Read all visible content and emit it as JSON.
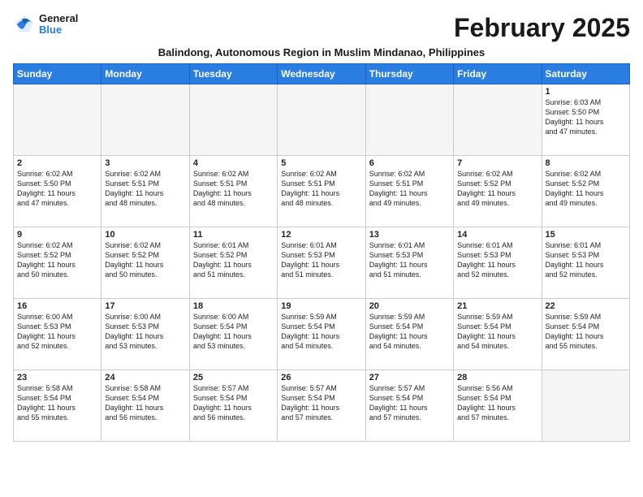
{
  "logo": {
    "line1": "General",
    "line2": "Blue"
  },
  "title": "February 2025",
  "subtitle": "Balindong, Autonomous Region in Muslim Mindanao, Philippines",
  "weekdays": [
    "Sunday",
    "Monday",
    "Tuesday",
    "Wednesday",
    "Thursday",
    "Friday",
    "Saturday"
  ],
  "weeks": [
    [
      {
        "day": "",
        "info": ""
      },
      {
        "day": "",
        "info": ""
      },
      {
        "day": "",
        "info": ""
      },
      {
        "day": "",
        "info": ""
      },
      {
        "day": "",
        "info": ""
      },
      {
        "day": "",
        "info": ""
      },
      {
        "day": "1",
        "info": "Sunrise: 6:03 AM\nSunset: 5:50 PM\nDaylight: 11 hours\nand 47 minutes."
      }
    ],
    [
      {
        "day": "2",
        "info": "Sunrise: 6:02 AM\nSunset: 5:50 PM\nDaylight: 11 hours\nand 47 minutes."
      },
      {
        "day": "3",
        "info": "Sunrise: 6:02 AM\nSunset: 5:51 PM\nDaylight: 11 hours\nand 48 minutes."
      },
      {
        "day": "4",
        "info": "Sunrise: 6:02 AM\nSunset: 5:51 PM\nDaylight: 11 hours\nand 48 minutes."
      },
      {
        "day": "5",
        "info": "Sunrise: 6:02 AM\nSunset: 5:51 PM\nDaylight: 11 hours\nand 48 minutes."
      },
      {
        "day": "6",
        "info": "Sunrise: 6:02 AM\nSunset: 5:51 PM\nDaylight: 11 hours\nand 49 minutes."
      },
      {
        "day": "7",
        "info": "Sunrise: 6:02 AM\nSunset: 5:52 PM\nDaylight: 11 hours\nand 49 minutes."
      },
      {
        "day": "8",
        "info": "Sunrise: 6:02 AM\nSunset: 5:52 PM\nDaylight: 11 hours\nand 49 minutes."
      }
    ],
    [
      {
        "day": "9",
        "info": "Sunrise: 6:02 AM\nSunset: 5:52 PM\nDaylight: 11 hours\nand 50 minutes."
      },
      {
        "day": "10",
        "info": "Sunrise: 6:02 AM\nSunset: 5:52 PM\nDaylight: 11 hours\nand 50 minutes."
      },
      {
        "day": "11",
        "info": "Sunrise: 6:01 AM\nSunset: 5:52 PM\nDaylight: 11 hours\nand 51 minutes."
      },
      {
        "day": "12",
        "info": "Sunrise: 6:01 AM\nSunset: 5:53 PM\nDaylight: 11 hours\nand 51 minutes."
      },
      {
        "day": "13",
        "info": "Sunrise: 6:01 AM\nSunset: 5:53 PM\nDaylight: 11 hours\nand 51 minutes."
      },
      {
        "day": "14",
        "info": "Sunrise: 6:01 AM\nSunset: 5:53 PM\nDaylight: 11 hours\nand 52 minutes."
      },
      {
        "day": "15",
        "info": "Sunrise: 6:01 AM\nSunset: 5:53 PM\nDaylight: 11 hours\nand 52 minutes."
      }
    ],
    [
      {
        "day": "16",
        "info": "Sunrise: 6:00 AM\nSunset: 5:53 PM\nDaylight: 11 hours\nand 52 minutes."
      },
      {
        "day": "17",
        "info": "Sunrise: 6:00 AM\nSunset: 5:53 PM\nDaylight: 11 hours\nand 53 minutes."
      },
      {
        "day": "18",
        "info": "Sunrise: 6:00 AM\nSunset: 5:54 PM\nDaylight: 11 hours\nand 53 minutes."
      },
      {
        "day": "19",
        "info": "Sunrise: 5:59 AM\nSunset: 5:54 PM\nDaylight: 11 hours\nand 54 minutes."
      },
      {
        "day": "20",
        "info": "Sunrise: 5:59 AM\nSunset: 5:54 PM\nDaylight: 11 hours\nand 54 minutes."
      },
      {
        "day": "21",
        "info": "Sunrise: 5:59 AM\nSunset: 5:54 PM\nDaylight: 11 hours\nand 54 minutes."
      },
      {
        "day": "22",
        "info": "Sunrise: 5:59 AM\nSunset: 5:54 PM\nDaylight: 11 hours\nand 55 minutes."
      }
    ],
    [
      {
        "day": "23",
        "info": "Sunrise: 5:58 AM\nSunset: 5:54 PM\nDaylight: 11 hours\nand 55 minutes."
      },
      {
        "day": "24",
        "info": "Sunrise: 5:58 AM\nSunset: 5:54 PM\nDaylight: 11 hours\nand 56 minutes."
      },
      {
        "day": "25",
        "info": "Sunrise: 5:57 AM\nSunset: 5:54 PM\nDaylight: 11 hours\nand 56 minutes."
      },
      {
        "day": "26",
        "info": "Sunrise: 5:57 AM\nSunset: 5:54 PM\nDaylight: 11 hours\nand 57 minutes."
      },
      {
        "day": "27",
        "info": "Sunrise: 5:57 AM\nSunset: 5:54 PM\nDaylight: 11 hours\nand 57 minutes."
      },
      {
        "day": "28",
        "info": "Sunrise: 5:56 AM\nSunset: 5:54 PM\nDaylight: 11 hours\nand 57 minutes."
      },
      {
        "day": "",
        "info": ""
      }
    ]
  ]
}
